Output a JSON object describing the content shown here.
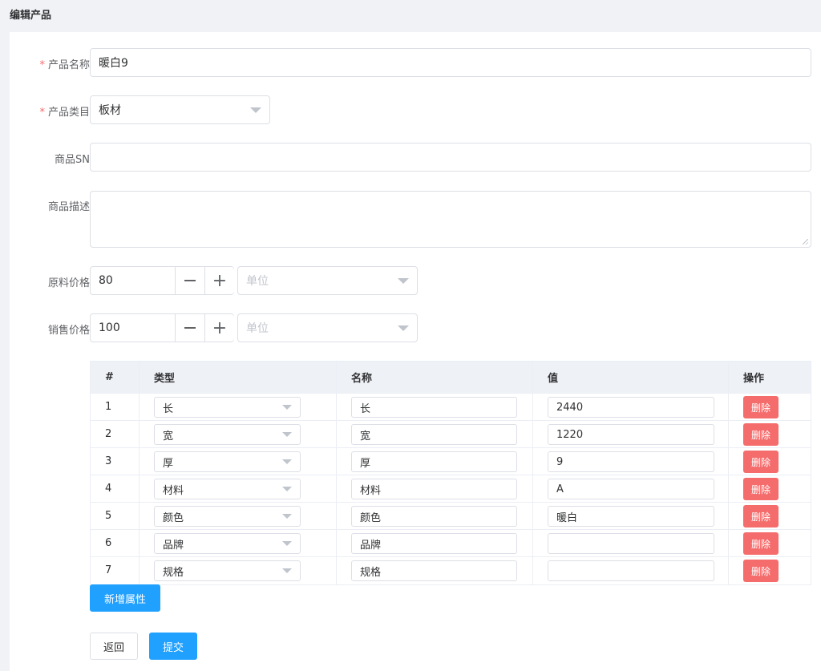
{
  "header": {
    "title": "编辑产品"
  },
  "form": {
    "name": {
      "label": "产品名称",
      "value": "暖白9"
    },
    "category": {
      "label": "产品类目",
      "value": "板材"
    },
    "sn": {
      "label": "商品SN",
      "value": ""
    },
    "desc": {
      "label": "商品描述",
      "value": ""
    },
    "cost": {
      "label": "原料价格",
      "value": "80",
      "unit_placeholder": "单位"
    },
    "price": {
      "label": "销售价格",
      "value": "100",
      "unit_placeholder": "单位"
    }
  },
  "table": {
    "headers": [
      "#",
      "类型",
      "名称",
      "值",
      "操作"
    ],
    "rows": [
      {
        "idx": "1",
        "type": "长",
        "name": "长",
        "value": "2440"
      },
      {
        "idx": "2",
        "type": "宽",
        "name": "宽",
        "value": "1220"
      },
      {
        "idx": "3",
        "type": "厚",
        "name": "厚",
        "value": "9"
      },
      {
        "idx": "4",
        "type": "材料",
        "name": "材料",
        "value": "A"
      },
      {
        "idx": "5",
        "type": "颜色",
        "name": "颜色",
        "value": "暖白"
      },
      {
        "idx": "6",
        "type": "品牌",
        "name": "品牌",
        "value": ""
      },
      {
        "idx": "7",
        "type": "规格",
        "name": "规格",
        "value": ""
      }
    ],
    "delete_label": "删除"
  },
  "actions": {
    "add_attr": "新增属性",
    "back": "返回",
    "submit": "提交"
  },
  "colors": {
    "primary": "#20a0ff",
    "danger": "#f56c6c",
    "required": "#f56c6c"
  }
}
